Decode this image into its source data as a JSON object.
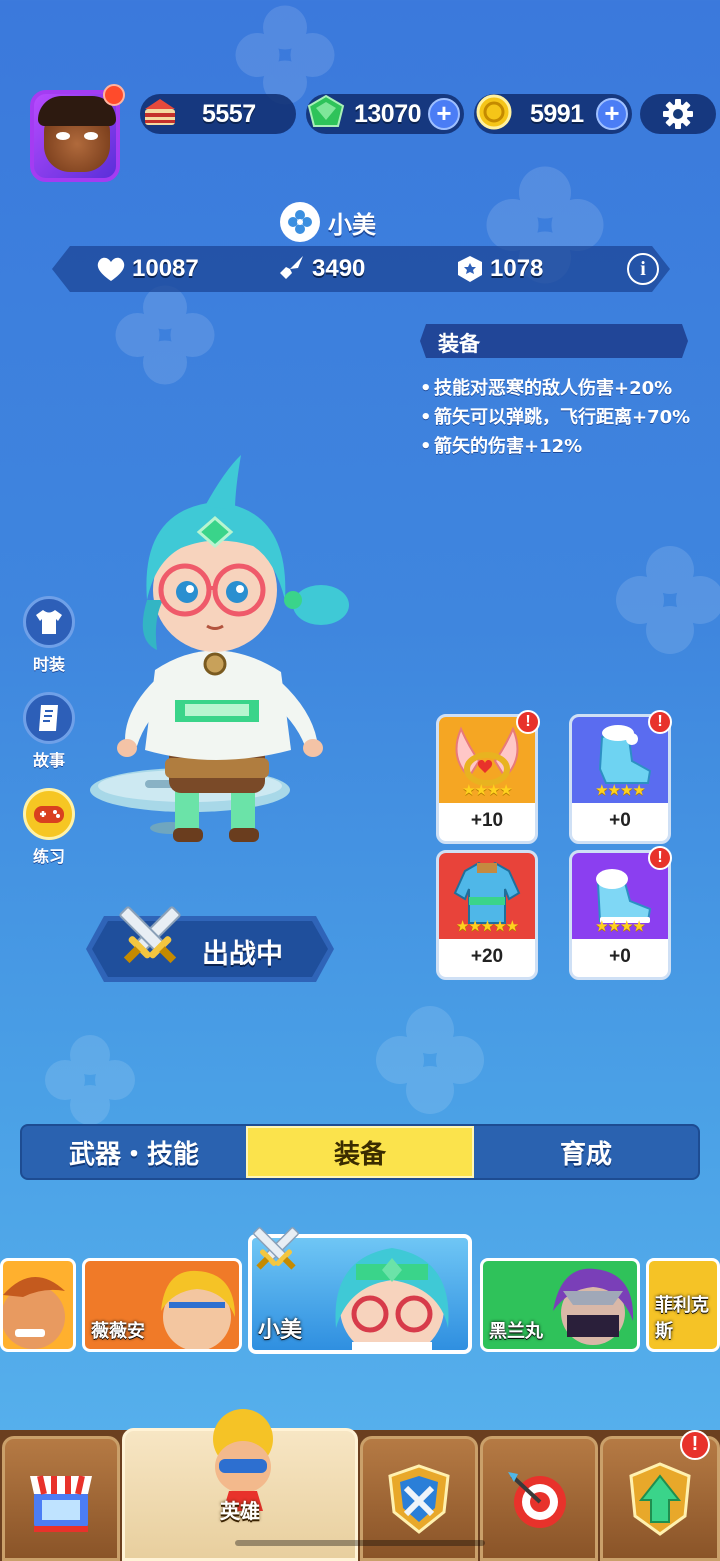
{
  "resources": {
    "cake": "5557",
    "gems": "13070",
    "coins": "5991"
  },
  "hero": {
    "name": "小美",
    "stats": {
      "hp": "10087",
      "attack": "3490",
      "power": "1078"
    }
  },
  "equipment_panel": {
    "title": "装备",
    "bonuses": [
      "技能对恶寒的敌人伤害+20%",
      "箭矢可以弹跳，飞行距离+70%",
      "箭矢的伤害+12%"
    ]
  },
  "side_buttons": {
    "costume": "时装",
    "story": "故事",
    "practice": "练习"
  },
  "deploy_label": "出战中",
  "slots": [
    {
      "level": "+10",
      "stars": "★★★★",
      "alert": "!",
      "color": "#f5a623"
    },
    {
      "level": "+0",
      "stars": "★★★★",
      "alert": "!",
      "color": "#5a6cf0"
    },
    {
      "level": "+20",
      "stars": "★★★★★",
      "alert": "",
      "color": "#e8433a"
    },
    {
      "level": "+0",
      "stars": "★★★★",
      "alert": "!",
      "color": "#8b3ff0"
    }
  ],
  "tabs": [
    "武器・技能",
    "装备",
    "育成"
  ],
  "heroes": [
    {
      "name": ""
    },
    {
      "name": "薇薇安"
    },
    {
      "name": "小美"
    },
    {
      "name": "黑兰丸"
    },
    {
      "name": "菲利克斯"
    }
  ],
  "nav": {
    "hero_label": "英雄",
    "upgrade_alert": "!"
  },
  "colors": {
    "background": "#3f86de",
    "tab_active": "#fbe34c",
    "alert": "#e8322b"
  }
}
